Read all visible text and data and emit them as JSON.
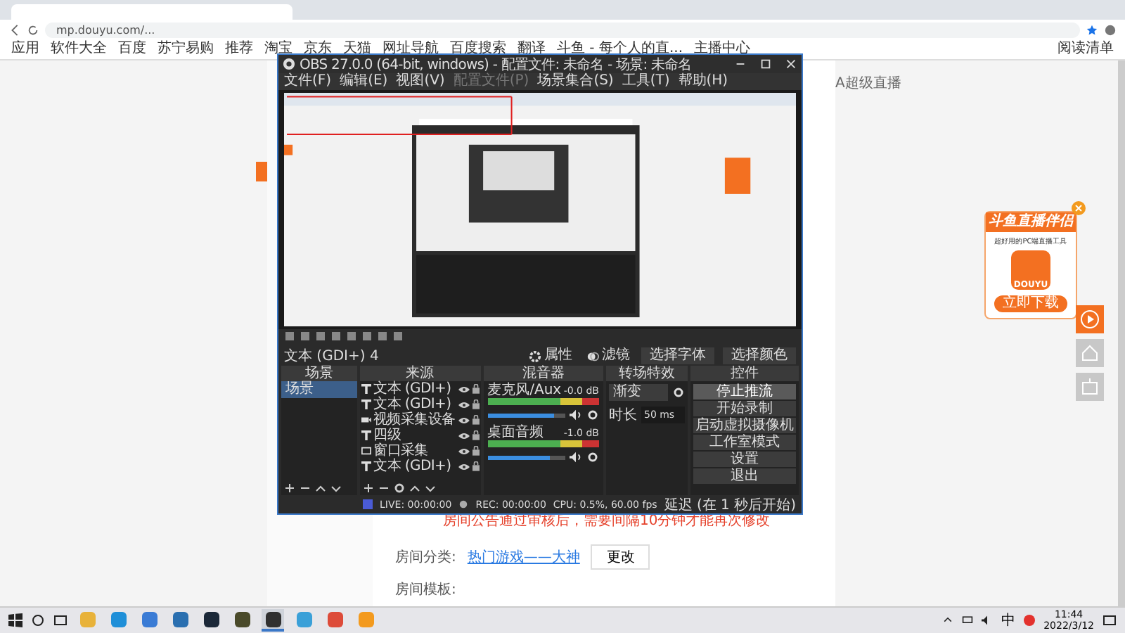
{
  "browser": {
    "url": "mp.douyu.com/...",
    "bookmarks": [
      "应用",
      "软件大全",
      "百度",
      "苏宁易购",
      "推荐",
      "淘宝",
      "京东",
      "天猫",
      "网址导航",
      "百度搜索",
      "翻译",
      "斗鱼 - 每个人的直...",
      "主播中心"
    ],
    "reading_list": "阅读清单"
  },
  "page": {
    "top_link": "A超级直播",
    "notice": "房间公告通过审核后，需要间隔10分钟才能再次修改",
    "category_label": "房间分类:",
    "category_link": "热门游戏——大神",
    "change_button": "更改",
    "template_label": "房间模板:"
  },
  "ad": {
    "title": "斗鱼直播伴侣",
    "subtitle": "超好用的PC端直播工具",
    "app_label": "DOUYU",
    "download_button": "立即下载"
  },
  "obs": {
    "title": "OBS 27.0.0 (64-bit, windows) - 配置文件: 未命名 - 场景: 未命名",
    "menu": [
      {
        "label": "文件(F)",
        "disabled": false
      },
      {
        "label": "编辑(E)",
        "disabled": false
      },
      {
        "label": "视图(V)",
        "disabled": false
      },
      {
        "label": "配置文件(P)",
        "disabled": true
      },
      {
        "label": "场景集合(S)",
        "disabled": false
      },
      {
        "label": "工具(T)",
        "disabled": false
      },
      {
        "label": "帮助(H)",
        "disabled": false
      }
    ],
    "selected_source": "文本 (GDI+) 4",
    "source_buttons": [
      {
        "kind": "properties",
        "label": "属性"
      },
      {
        "kind": "filters",
        "label": "滤镜"
      },
      {
        "kind": "plain",
        "label": "选择字体"
      },
      {
        "kind": "plain",
        "label": "选择颜色"
      }
    ],
    "dock_titles": [
      "场景",
      "来源",
      "混音器",
      "转场特效",
      "控件"
    ],
    "scenes": [
      {
        "name": "场景",
        "selected": true
      }
    ],
    "sources": [
      {
        "kind": "text",
        "name": "文本 (GDI+)",
        "visible": true
      },
      {
        "kind": "text",
        "name": "文本 (GDI+)",
        "visible": true
      },
      {
        "kind": "camera",
        "name": "视频采集设备",
        "visible": true
      },
      {
        "kind": "text",
        "name": "四级",
        "visible": true
      },
      {
        "kind": "window",
        "name": "窗口采集",
        "visible": true
      },
      {
        "kind": "text",
        "name": "文本 (GDI+)",
        "visible": true
      }
    ],
    "mixer": [
      {
        "name": "麦克风/Aux",
        "reading": "-0.0 dB",
        "level": 0.85
      },
      {
        "name": "桌面音频",
        "reading": "-1.0 dB",
        "level": 0.8
      }
    ],
    "transition": {
      "type": "渐变",
      "duration_label": "时长",
      "duration": "50 ms"
    },
    "controls": [
      {
        "label": "停止推流",
        "active": true
      },
      {
        "label": "开始录制",
        "active": false
      },
      {
        "label": "启动虚拟摄像机",
        "active": false
      },
      {
        "label": "工作室模式",
        "active": false
      },
      {
        "label": "设置",
        "active": false
      },
      {
        "label": "退出",
        "active": false
      }
    ],
    "status": {
      "live": "LIVE: 00:00:00",
      "rec": "REC: 00:00:00",
      "cpu": "CPU: 0.5%, 60.00 fps",
      "delay": "延迟 (在 1 秒后开始)"
    }
  },
  "taskbar": {
    "apps": [
      {
        "kind": "folder",
        "selected": false
      },
      {
        "kind": "edge",
        "selected": false
      },
      {
        "kind": "store",
        "selected": false
      },
      {
        "kind": "disc",
        "selected": false
      },
      {
        "kind": "steam",
        "selected": false
      },
      {
        "kind": "game",
        "selected": false
      },
      {
        "kind": "obs",
        "selected": true
      },
      {
        "kind": "s-app",
        "selected": false
      },
      {
        "kind": "chrome",
        "selected": false
      },
      {
        "kind": "orange-app",
        "selected": false
      }
    ],
    "ime": "中",
    "time": "11:44",
    "date": "2022/3/12"
  }
}
